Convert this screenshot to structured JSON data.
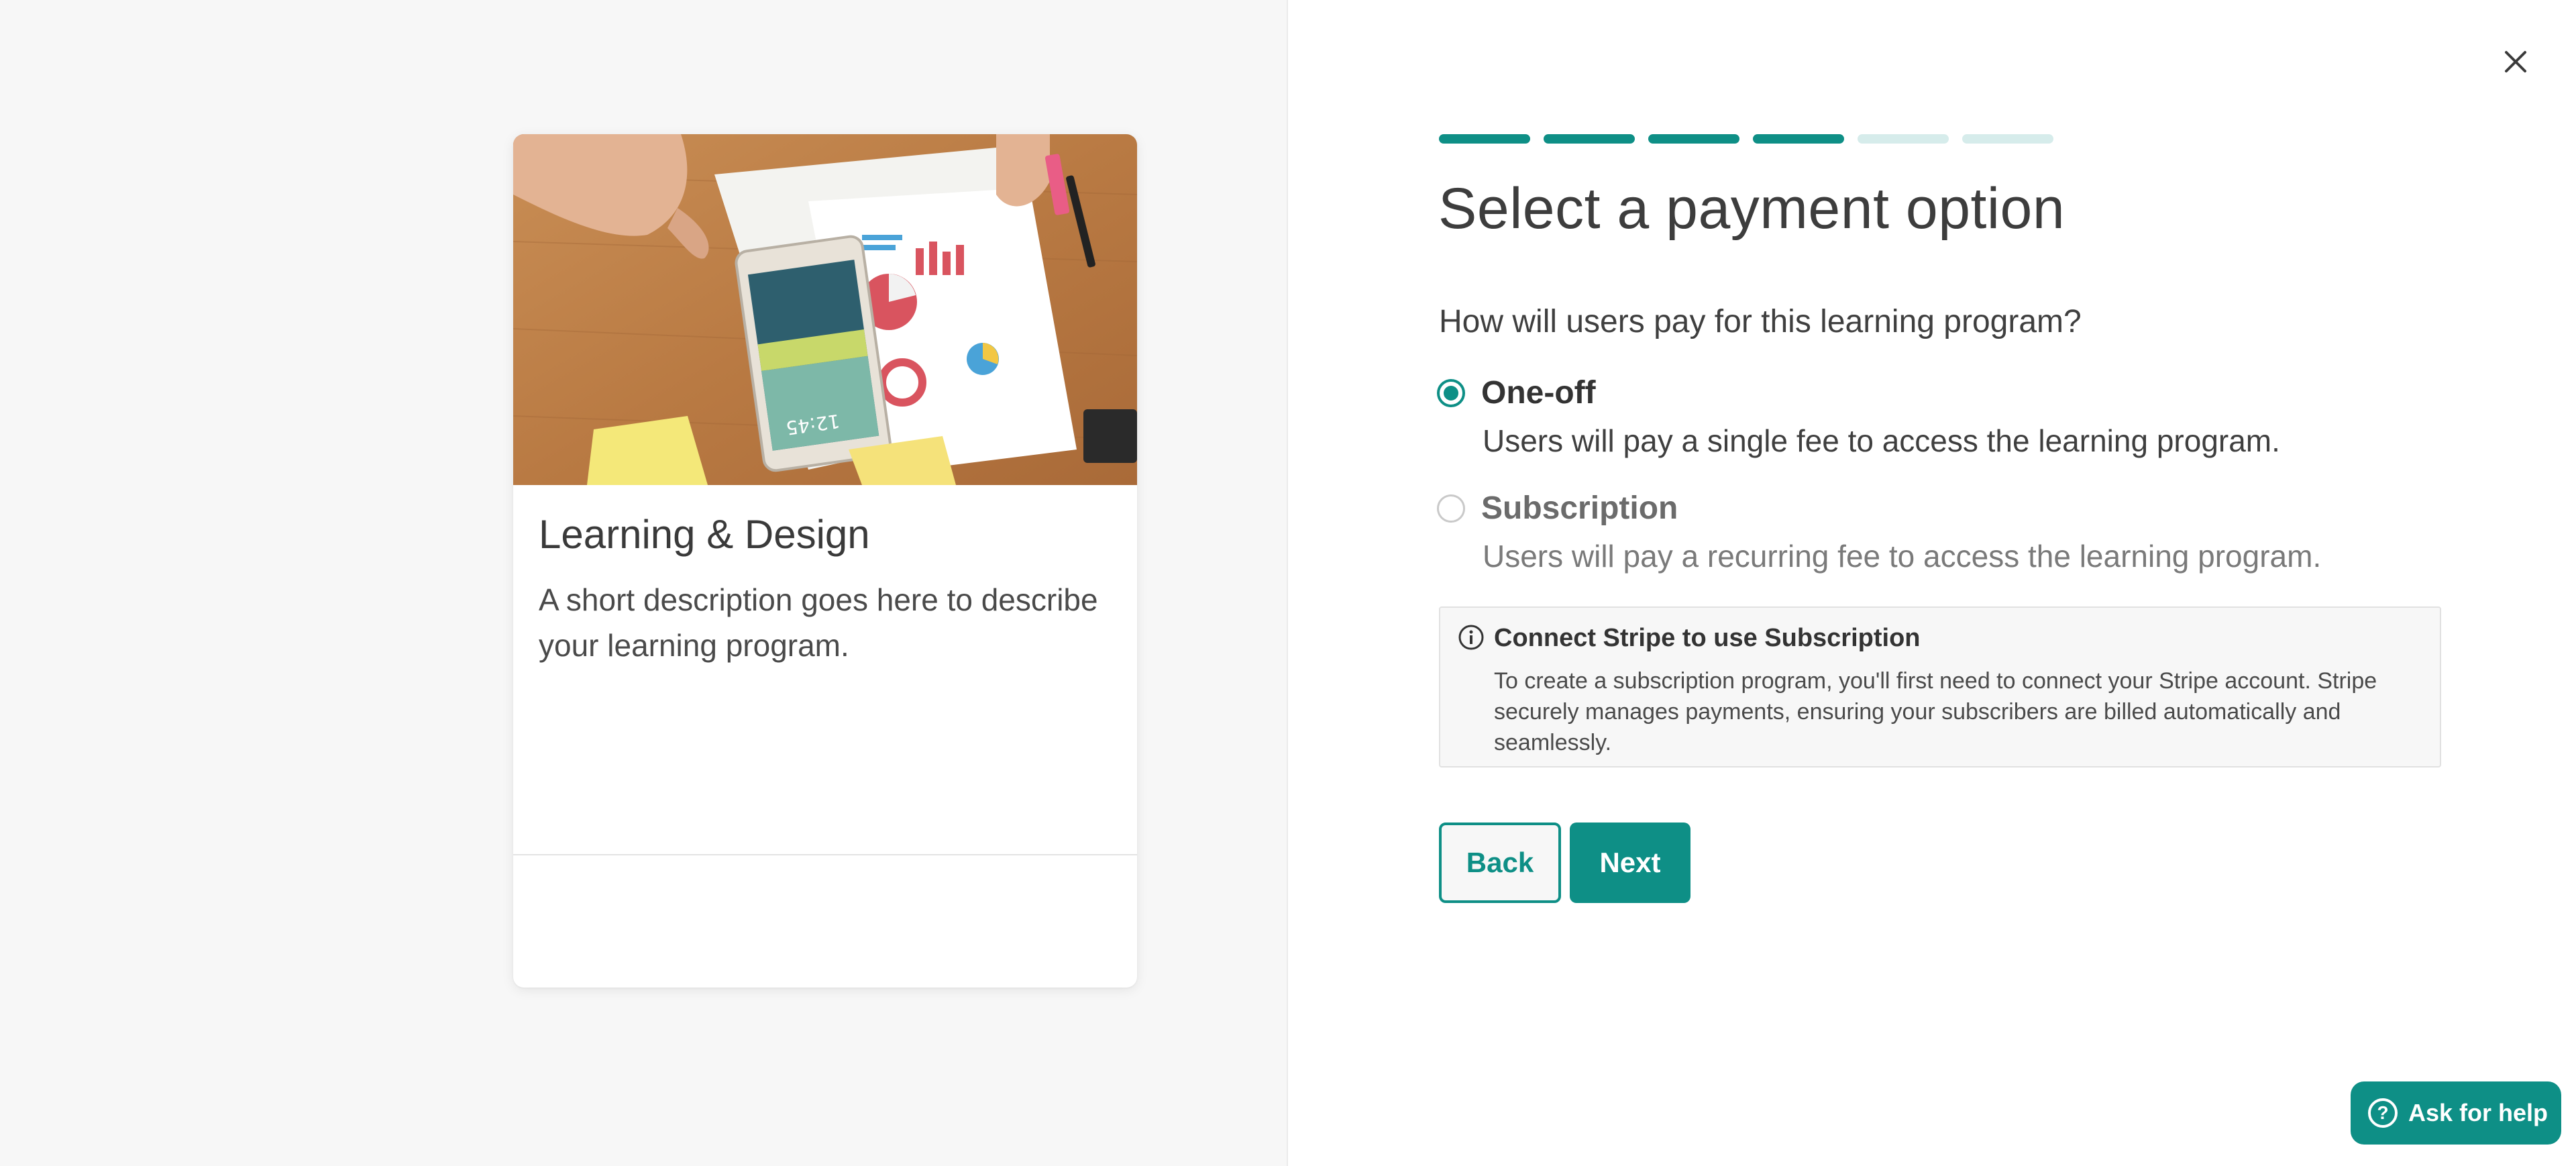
{
  "card": {
    "title": "Learning & Design",
    "description": "A short description goes here to describe your learning program."
  },
  "progress": {
    "total_steps": 6,
    "completed_steps": 4
  },
  "form": {
    "heading": "Select a payment option",
    "question": "How will users pay for this learning program?",
    "options": [
      {
        "label": "One-off",
        "description": "Users will pay a single fee to access the learning program.",
        "selected": true
      },
      {
        "label": "Subscription",
        "description": "Users will pay a recurring fee to access the learning program.",
        "selected": false
      }
    ],
    "notice": {
      "title": "Connect Stripe to use Subscription",
      "text": "To create a subscription program, you'll first need to connect your Stripe account. Stripe securely manages payments, ensuring your subscribers are billed automatically and seamlessly."
    },
    "back_label": "Back",
    "next_label": "Next"
  },
  "help": {
    "label": "Ask for help"
  },
  "colors": {
    "accent": "#0e8f86",
    "accent_light": "#d6eceb"
  }
}
